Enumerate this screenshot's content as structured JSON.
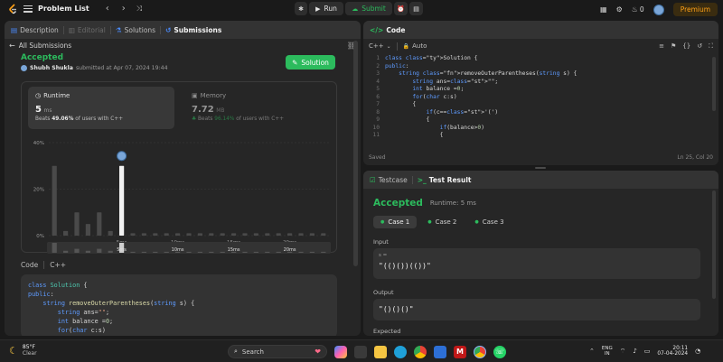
{
  "topbar": {
    "title": "Problem List",
    "run": "Run",
    "submit": "Submit",
    "coins": "0",
    "premium": "Premium"
  },
  "left": {
    "tabs": [
      "Description",
      "Editorial",
      "Solutions",
      "Submissions"
    ],
    "back": "All Submissions",
    "status": "Accepted",
    "user": "Shubh Shukla",
    "submitted": "submitted at Apr 07, 2024 19:44",
    "solution_btn": "Solution",
    "runtime_label": "Runtime",
    "runtime_value": "5",
    "runtime_unit": "ms",
    "runtime_beats_prefix": "Beats",
    "runtime_beats": "49.06%",
    "runtime_beats_suffix": "of users with C++",
    "memory_label": "Memory",
    "memory_value": "7.72",
    "memory_unit": "MB",
    "memory_beats_prefix": "Beats",
    "memory_beats": "96.14%",
    "memory_beats_suffix": "of users with C++",
    "code_label": "Code",
    "code_lang": "C++",
    "code": [
      "class Solution {",
      "public:",
      "    string removeOuterParentheses(string s) {",
      "        string ans=\"\";",
      "        int balance =0;",
      "        for(char c:s)"
    ]
  },
  "chart_data": {
    "type": "bar",
    "ylim": [
      0,
      40
    ],
    "yticks": [
      "40%",
      "20%",
      "0%"
    ],
    "xticks": [
      "5ms",
      "10ms",
      "15ms",
      "20ms"
    ],
    "highlight_index": 6,
    "values": [
      30,
      2,
      10,
      5,
      10,
      2,
      30,
      1,
      1,
      1,
      1,
      1,
      1,
      1,
      1,
      1,
      1,
      1,
      1,
      1,
      1,
      1,
      1,
      1,
      1
    ],
    "mini_values": [
      10,
      2,
      4,
      2,
      4,
      2,
      10,
      1,
      1,
      1,
      1,
      1,
      1,
      1,
      1,
      1,
      1,
      1,
      1,
      1,
      1,
      1,
      1,
      1,
      1
    ]
  },
  "editor": {
    "tab": "Code",
    "lang": "C++",
    "auto": "Auto",
    "saved": "Saved",
    "cursor": "Ln 25, Col 20",
    "lines": [
      {
        "n": "1",
        "t": "class Solution {"
      },
      {
        "n": "2",
        "t": "public:"
      },
      {
        "n": "3",
        "t": "    string removeOuterParentheses(string s) {"
      },
      {
        "n": "4",
        "t": "        string ans=\"\";"
      },
      {
        "n": "5",
        "t": "        int balance =0;"
      },
      {
        "n": "6",
        "t": "        for(char c:s)"
      },
      {
        "n": "7",
        "t": "        {"
      },
      {
        "n": "8",
        "t": "            if(c=='(')"
      },
      {
        "n": "9",
        "t": "            {"
      },
      {
        "n": "10",
        "t": "                if(balance>0)"
      },
      {
        "n": "11",
        "t": "                {"
      }
    ]
  },
  "result": {
    "tab_testcase": "Testcase",
    "tab_result": "Test Result",
    "status": "Accepted",
    "runtime": "Runtime: 5 ms",
    "cases": [
      "Case 1",
      "Case 2",
      "Case 3"
    ],
    "input_label": "Input",
    "var": "s =",
    "input_value": "\"(()())(())\"",
    "output_label": "Output",
    "output_value": "\"()()()\"",
    "expected_label": "Expected"
  },
  "taskbar": {
    "temp": "85°F",
    "weather": "Clear",
    "search": "Search",
    "lang1": "ENG",
    "lang2": "IN",
    "time": "20:11",
    "date": "07-04-2024"
  }
}
